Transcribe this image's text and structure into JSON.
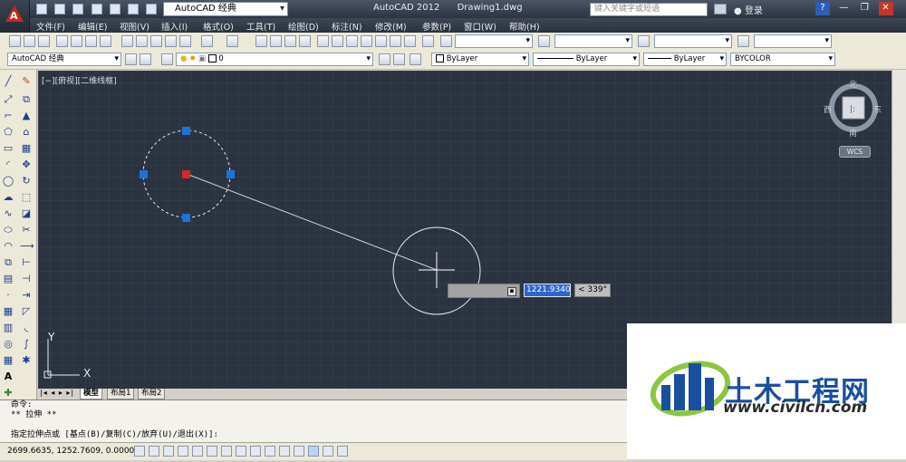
{
  "titlebar": {
    "workspace": "AutoCAD 经典",
    "app_name": "AutoCAD 2012",
    "doc_name": "Drawing1.dwg",
    "search_placeholder": "键入关键字或短语",
    "login": "登录"
  },
  "menu": [
    "文件(F)",
    "编辑(E)",
    "视图(V)",
    "插入(I)",
    "格式(O)",
    "工具(T)",
    "绘图(D)",
    "标注(N)",
    "修改(M)",
    "参数(P)",
    "窗口(W)",
    "帮助(H)"
  ],
  "toolbar2": {
    "workspace_combo": "AutoCAD 经典",
    "layer_value": "0",
    "color_combo": "ByLayer",
    "linetype_combo": "ByLayer",
    "lineweight_combo": "ByLayer",
    "plotstyle_combo": "BYCOLOR"
  },
  "viewport_label": "[−][俯视][二维线框]",
  "viewcube": {
    "north": "北",
    "south": "南",
    "east": "东",
    "west": "西",
    "wcs": "WCS"
  },
  "ucs": {
    "x": "X",
    "y": "Y"
  },
  "dynamic_input": {
    "value": "1221.9340",
    "angle": "< 339°"
  },
  "tabs": [
    "模型",
    "布局1",
    "布局2"
  ],
  "command_lines": [
    "命令:",
    "** 拉伸 **",
    "指定拉伸点或 [基点(B)/复制(C)/放弃(U)/退出(X)]:"
  ],
  "status": {
    "coords": "2699.6635,  1252.7609,  0.0000"
  },
  "watermark": {
    "name": "土木工程网",
    "url": "www.civilcn.com"
  },
  "colors": {
    "canvas": "#2b3340",
    "grip": "#1e73d6",
    "logo_blue": "#1a4fa0",
    "logo_green": "#8cc63f"
  }
}
